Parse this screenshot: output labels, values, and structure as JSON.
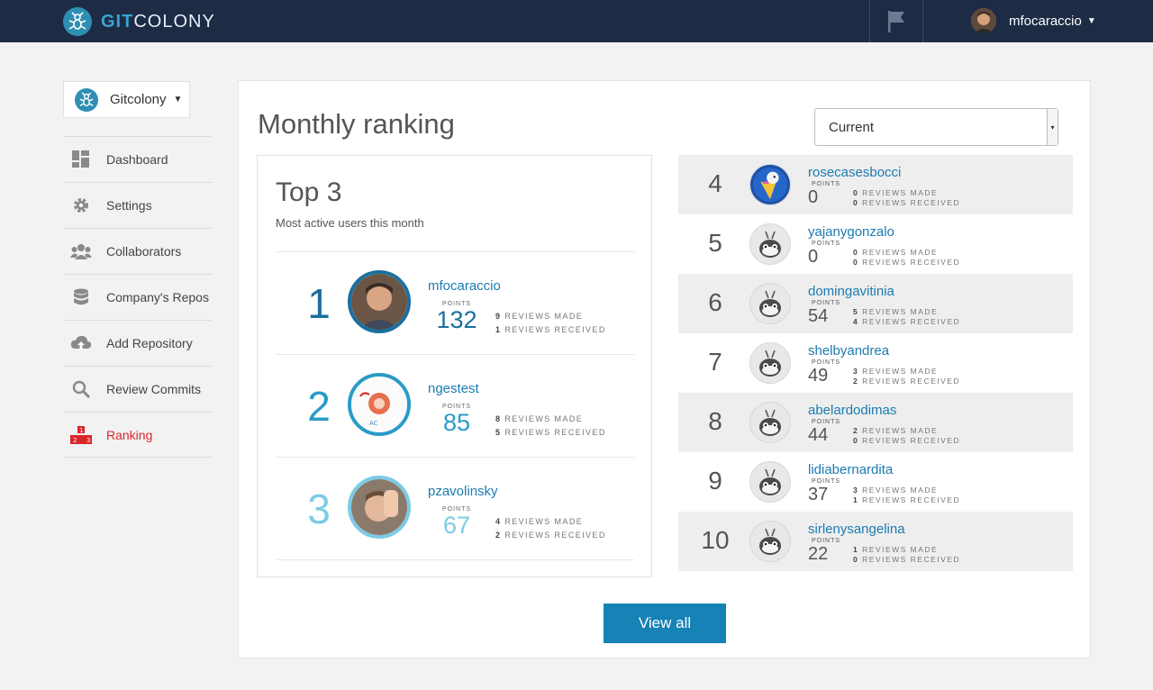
{
  "brand": {
    "prefix": "GIT",
    "suffix": "COLONY"
  },
  "header": {
    "username": "mfocaraccio"
  },
  "org": {
    "name": "Gitcolony"
  },
  "sidebar": {
    "items": [
      {
        "label": "Dashboard",
        "icon": "dashboard-icon"
      },
      {
        "label": "Settings",
        "icon": "gear-icon"
      },
      {
        "label": "Collaborators",
        "icon": "users-icon"
      },
      {
        "label": "Company's Repos",
        "icon": "database-icon"
      },
      {
        "label": "Add Repository",
        "icon": "cloud-upload-icon"
      },
      {
        "label": "Review Commits",
        "icon": "search-icon"
      },
      {
        "label": "Ranking",
        "icon": "ranking-icon",
        "active": true
      }
    ]
  },
  "main": {
    "title": "Monthly ranking",
    "period": "Current",
    "top3": {
      "title": "Top 3",
      "subtitle": "Most active users this month",
      "points_label": "POINTS",
      "made_label": "REVIEWS MADE",
      "received_label": "REVIEWS RECEIVED",
      "entries": [
        {
          "rank": "1",
          "name": "mfocaraccio",
          "points": "132",
          "made": "9",
          "received": "1",
          "color": "#1a6f9e"
        },
        {
          "rank": "2",
          "name": "ngestest",
          "points": "85",
          "made": "8",
          "received": "5",
          "color": "#2a9bc7"
        },
        {
          "rank": "3",
          "name": "pzavolinsky",
          "points": "67",
          "made": "4",
          "received": "2",
          "color": "#7ccbe5"
        }
      ]
    },
    "list": [
      {
        "rank": "4",
        "name": "rosecasesbocci",
        "points": "0",
        "made": "0",
        "received": "0"
      },
      {
        "rank": "5",
        "name": "yajanygonzalo",
        "points": "0",
        "made": "0",
        "received": "0"
      },
      {
        "rank": "6",
        "name": "domingavitinia",
        "points": "54",
        "made": "5",
        "received": "4"
      },
      {
        "rank": "7",
        "name": "shelbyandrea",
        "points": "49",
        "made": "3",
        "received": "2"
      },
      {
        "rank": "8",
        "name": "abelardodimas",
        "points": "44",
        "made": "2",
        "received": "0"
      },
      {
        "rank": "9",
        "name": "lidiabernardita",
        "points": "37",
        "made": "3",
        "received": "1"
      },
      {
        "rank": "10",
        "name": "sirlenysangelina",
        "points": "22",
        "made": "1",
        "received": "0"
      }
    ],
    "view_all": "View all"
  }
}
